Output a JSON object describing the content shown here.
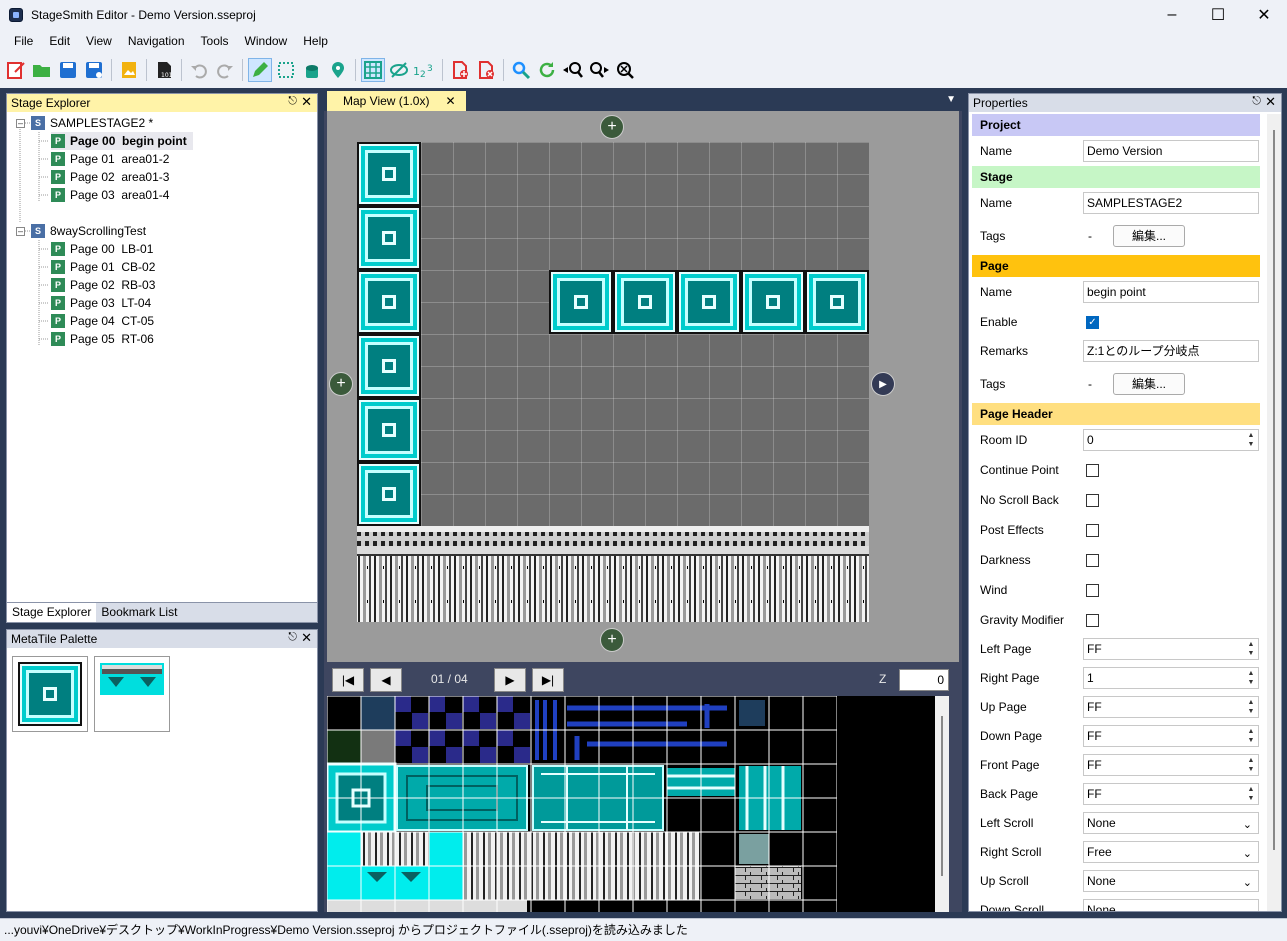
{
  "window": {
    "title": "StageSmith Editor - Demo Version.sseproj"
  },
  "menu": [
    "File",
    "Edit",
    "View",
    "Navigation",
    "Tools",
    "Window",
    "Help"
  ],
  "stage_explorer": {
    "title": "Stage Explorer",
    "stages": [
      {
        "name": "SAMPLESTAGE2 *",
        "pages": [
          "Page 00  begin point",
          "Page 01  area01-2",
          "Page 02  area01-3",
          "Page 03  area01-4"
        ]
      },
      {
        "name": "8wayScrollingTest",
        "pages": [
          "Page 00  LB-01",
          "Page 01  CB-02",
          "Page 02  RB-03",
          "Page 03  LT-04",
          "Page 04  CT-05",
          "Page 05  RT-06"
        ]
      }
    ],
    "tabs": [
      "Stage Explorer",
      "Bookmark List"
    ]
  },
  "metatile_palette": {
    "title": "MetaTile Palette"
  },
  "map_view": {
    "tab": "Map View (1.0x)",
    "page_counter": "01 / 04",
    "z_label": "Z",
    "z_value": "0",
    "nav": {
      "first": "|◀",
      "prev": "◀",
      "next": "▶",
      "last": "▶|"
    },
    "plus": "+"
  },
  "properties": {
    "title": "Properties",
    "categories": {
      "project": "Project",
      "stage": "Stage",
      "page": "Page",
      "page_header": "Page Header"
    },
    "cat_colors": {
      "project": "#c8c8f5",
      "stage": "#c6f6c6",
      "page": "#ffc20e",
      "page_header": "#ffdf80"
    },
    "project_name_label": "Name",
    "project_name": "Demo Version",
    "stage_name_label": "Name",
    "stage_name": "SAMPLESTAGE2",
    "stage_tags_label": "Tags",
    "stage_tags_value": "-",
    "edit_button": "編集...",
    "page_name_label": "Name",
    "page_name": "begin point",
    "enable_label": "Enable",
    "enable_checked": true,
    "remarks_label": "Remarks",
    "remarks": "Z:1とのループ分岐点",
    "page_tags_label": "Tags",
    "page_tags_value": "-",
    "room_id_label": "Room ID",
    "room_id": "0",
    "checks": [
      {
        "label": "Continue Point",
        "checked": false
      },
      {
        "label": "No Scroll Back",
        "checked": false
      },
      {
        "label": "Post Effects",
        "checked": false
      },
      {
        "label": "Darkness",
        "checked": false
      },
      {
        "label": "Wind",
        "checked": false
      },
      {
        "label": "Gravity Modifier",
        "checked": false
      }
    ],
    "pages": [
      {
        "label": "Left Page",
        "value": "FF"
      },
      {
        "label": "Right Page",
        "value": "1"
      },
      {
        "label": "Up Page",
        "value": "FF"
      },
      {
        "label": "Down Page",
        "value": "FF"
      },
      {
        "label": "Front Page",
        "value": "FF"
      },
      {
        "label": "Back Page",
        "value": "FF"
      }
    ],
    "scrolls": [
      {
        "label": "Left Scroll",
        "value": "None"
      },
      {
        "label": "Right Scroll",
        "value": "Free"
      },
      {
        "label": "Up Scroll",
        "value": "None"
      },
      {
        "label": "Down Scroll",
        "value": "None"
      }
    ]
  },
  "statusbar": "...youvi¥OneDrive¥デスクトップ¥WorkInProgress¥Demo Version.sseproj からプロジェクトファイル(.sseproj)を読み込みました"
}
